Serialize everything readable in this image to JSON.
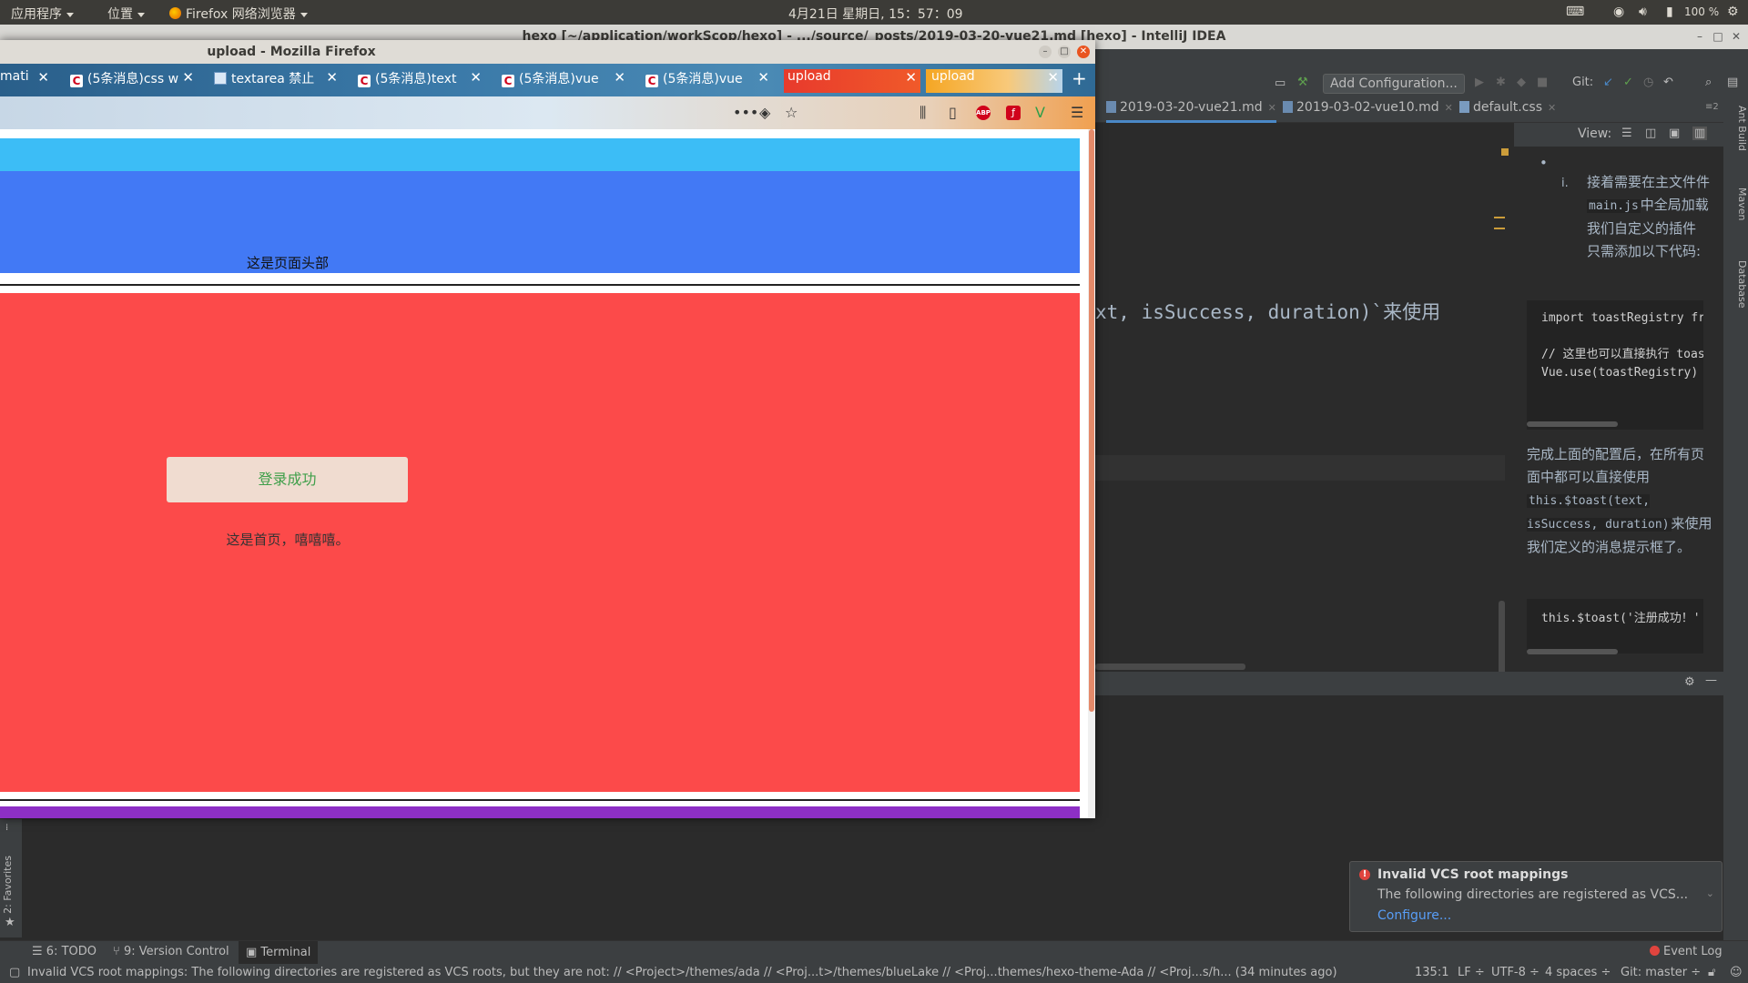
{
  "top_panel": {
    "apps_menu": "应用程序",
    "places_menu": "位置",
    "firefox_menu": "Firefox 网络浏览器",
    "clock": "4月21日 星期日, 15：57：09",
    "battery": "100 %"
  },
  "idea": {
    "window_title": "hexo [~/application/workScop/hexo] - .../source/_posts/2019-03-20-vue21.md [hexo] - IntelliJ IDEA",
    "toolbar": {
      "add_configuration": "Add Configuration...",
      "git_label": "Git:"
    },
    "editor_tabs": [
      {
        "label": "2019-03-20-vue21.md"
      },
      {
        "label": "2019-03-02-vue10.md"
      },
      {
        "label": "default.css"
      }
    ],
    "tab_count": "2",
    "editor_code": "xt, isSuccess, duration)`来使用",
    "preview": {
      "view_label": "View:",
      "bullet": "•",
      "step_num": "i.",
      "para1_a": "接着需要在主文件件",
      "para1_code": "main.js",
      "para1_b": "中全局加载我们自定义的插件 只需添加以下代码:",
      "code1_line1": "import toastRegistry fr",
      "code1_line2": "// 这里也可以直接执行 toas",
      "code1_line3": "Vue.use(toastRegistry)",
      "para2_a": "完成上面的配置后，在所有页面中都可以直接使用",
      "para2_code": "this.$toast(text, isSuccess, duration)",
      "para2_b": "来使用 我们定义的消息提示框了。",
      "code2_line1": "this.$toast('注册成功！'"
    },
    "right_strip": [
      "Ant Build",
      "Maven",
      "Database"
    ],
    "left_strip": "2: Favorites",
    "tool_tabs": {
      "todo": "6: TODO",
      "vcs": "9: Version Control",
      "terminal": "Terminal",
      "event_log": "Event Log"
    },
    "status": {
      "message": "Invalid VCS root mappings: The following directories are registered as VCS roots, but they are not: // <Project>/themes/ada // <Proj...t>/themes/blueLake // <Proj...themes/hexo-theme-Ada // <Proj...s/h... (34 minutes ago)",
      "position": "135:1",
      "line_sep": "LF ÷",
      "encoding": "UTF-8 ÷",
      "indent": "4 spaces ÷",
      "git": "Git: master ÷"
    },
    "balloon": {
      "title": "Invalid VCS root mappings",
      "body": "The following directories are registered as VCS...",
      "link": "Configure..."
    }
  },
  "firefox": {
    "window_title": "upload - Mozilla Firefox",
    "tabs": [
      {
        "label": "mati",
        "icon": "page-icon"
      },
      {
        "label": "(5条消息)css w",
        "icon": "csdn-icon"
      },
      {
        "label": "textarea 禁止",
        "icon": "web-icon"
      },
      {
        "label": "(5条消息)text",
        "icon": "csdn-icon"
      },
      {
        "label": "(5条消息)vue",
        "icon": "csdn-icon"
      },
      {
        "label": "(5条消息)vue",
        "icon": "csdn-icon"
      },
      {
        "label": "upload",
        "icon": ""
      },
      {
        "label": "upload",
        "icon": ""
      }
    ],
    "new_tab": "+",
    "page": {
      "header_text": "这是页面头部",
      "login_button": "登录成功",
      "main_text": "这是首页，嘻嘻嘻。"
    }
  },
  "colors": {
    "header_top": "#3cbdf6",
    "header": "#4279f5",
    "main": "#fc4a4a",
    "footer": "#8d2fc5",
    "login_text": "#3f9f4a"
  }
}
